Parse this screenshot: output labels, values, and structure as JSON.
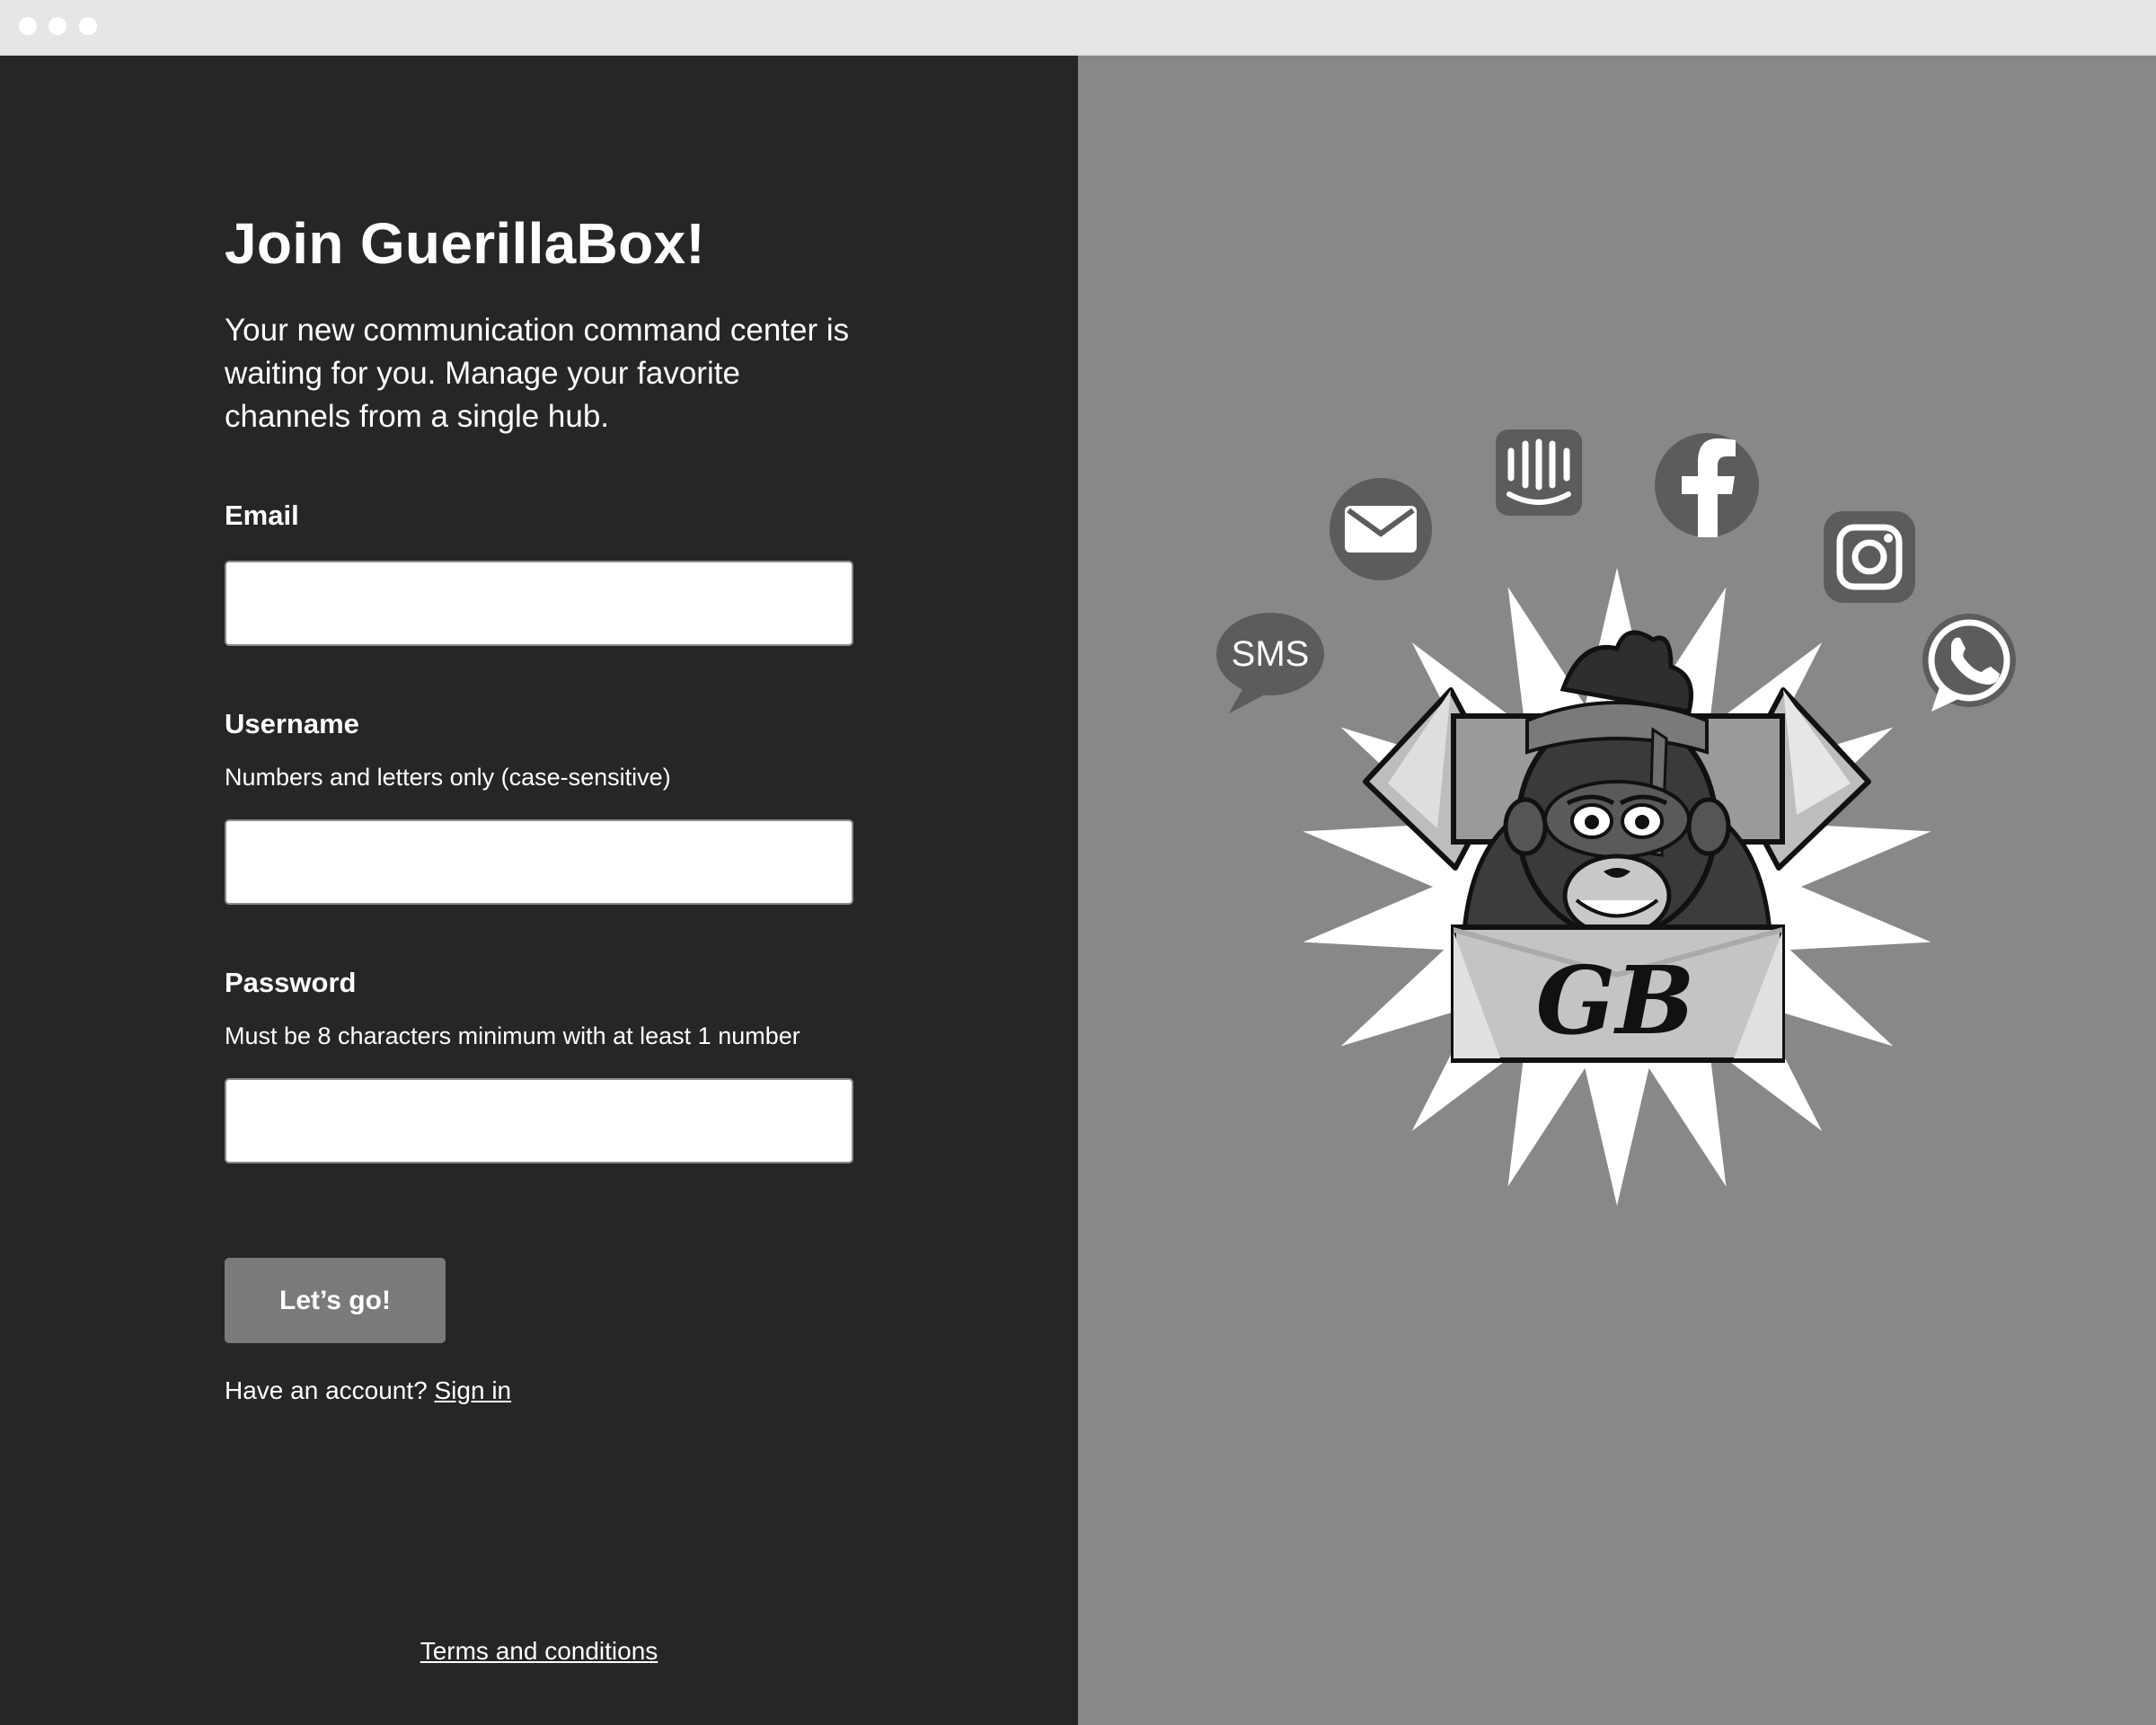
{
  "window": {
    "controls": [
      "close",
      "minimize",
      "maximize"
    ]
  },
  "signup": {
    "title": "Join GuerillaBox!",
    "subtitle": "Your new communication command center is waiting for you. Manage your favorite channels from a single hub.",
    "email": {
      "label": "Email",
      "value": "",
      "placeholder": ""
    },
    "username": {
      "label": "Username",
      "hint": "Numbers and letters only (case-sensitive)",
      "value": "",
      "placeholder": ""
    },
    "password": {
      "label": "Password",
      "hint": "Must be 8 characters minimum with at least 1 number",
      "value": "",
      "placeholder": ""
    },
    "submit_label": "Let’s go!",
    "account_prompt": "Have an account?",
    "signin_link": "Sign in",
    "terms_link": "Terms and conditions"
  },
  "illustration": {
    "box_label": "GB",
    "sms_label": "SMS",
    "channel_icons": [
      "sms-icon",
      "email-icon",
      "intercom-icon",
      "facebook-icon",
      "instagram-icon",
      "whatsapp-icon"
    ],
    "logo": "gorilla-in-box-logo"
  },
  "colors": {
    "left_panel": "#262626",
    "right_panel": "#888888",
    "button": "#7a7a7a",
    "titlebar": "#e6e6e6"
  }
}
